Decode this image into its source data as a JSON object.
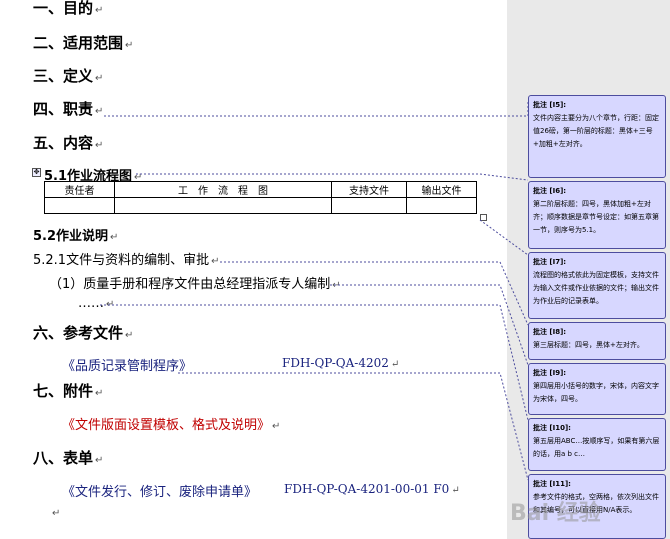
{
  "document": {
    "headings": {
      "h1": "一、目的",
      "h2": "二、适用范围",
      "h3": "三、定义",
      "h4": "四、职责",
      "h5": "五、内容",
      "h6": "六、参考文件",
      "h7": "七、附件",
      "h8": "八、表单"
    },
    "sub_5_1": "5.1作业流程图",
    "sub_5_2": "5.2作业说明",
    "line_5_2_1": "5.2.1文件与资料的编制、审批",
    "line_item_1": "（1）质量手册和程序文件由总经理指派专人编制",
    "line_ellipsis": "……",
    "table": {
      "headers": [
        "责任者",
        "工　作　流　程　图",
        "支持文件",
        "输出文件"
      ]
    },
    "ref_file_name": "《品质记录管制程序》",
    "ref_file_code": "FDH-QP-QA-4202",
    "attachment": "《文件版面设置模板、格式及说明》",
    "form_name": "《文件发行、修订、废除申请单》",
    "form_code": "FDH-QP-QA-4201-00-01 F0",
    "paragraph_mark": "↵"
  },
  "comments": [
    {
      "title": "批注 [I5]:",
      "body": "文件内容主要分为八个章节，行距：固定值26磅，第一阶层的标题：黑体+三号+加粗+左对齐。"
    },
    {
      "title": "批注 [I6]:",
      "body": "第二阶层标题：四号，黑体加粗+左对齐；顺序数据是章节号设定：如第五章第一节，则序号为5.1。"
    },
    {
      "title": "批注 [I7]:",
      "body": "流程图的格式依此为固定模板，支持文件为输入文件或作业依据的文件；输出文件为作业后的记录表单。"
    },
    {
      "title": "批注 [I8]:",
      "body": "第三层标题：四号，黑体+左对齐。"
    },
    {
      "title": "批注 [I9]:",
      "body": "第四层用小括号的数字，宋体，内容文字为宋体，四号。"
    },
    {
      "title": "批注 [I10]:",
      "body": "第五层用ABC…按顺序写，如果有第六层的话，用a b c…"
    },
    {
      "title": "批注 [I11]:",
      "body": "参考文件的格式，空两格，依次列出文件和其编号，可以直接用N/A表示。"
    }
  ],
  "watermark": "Bai 经验"
}
